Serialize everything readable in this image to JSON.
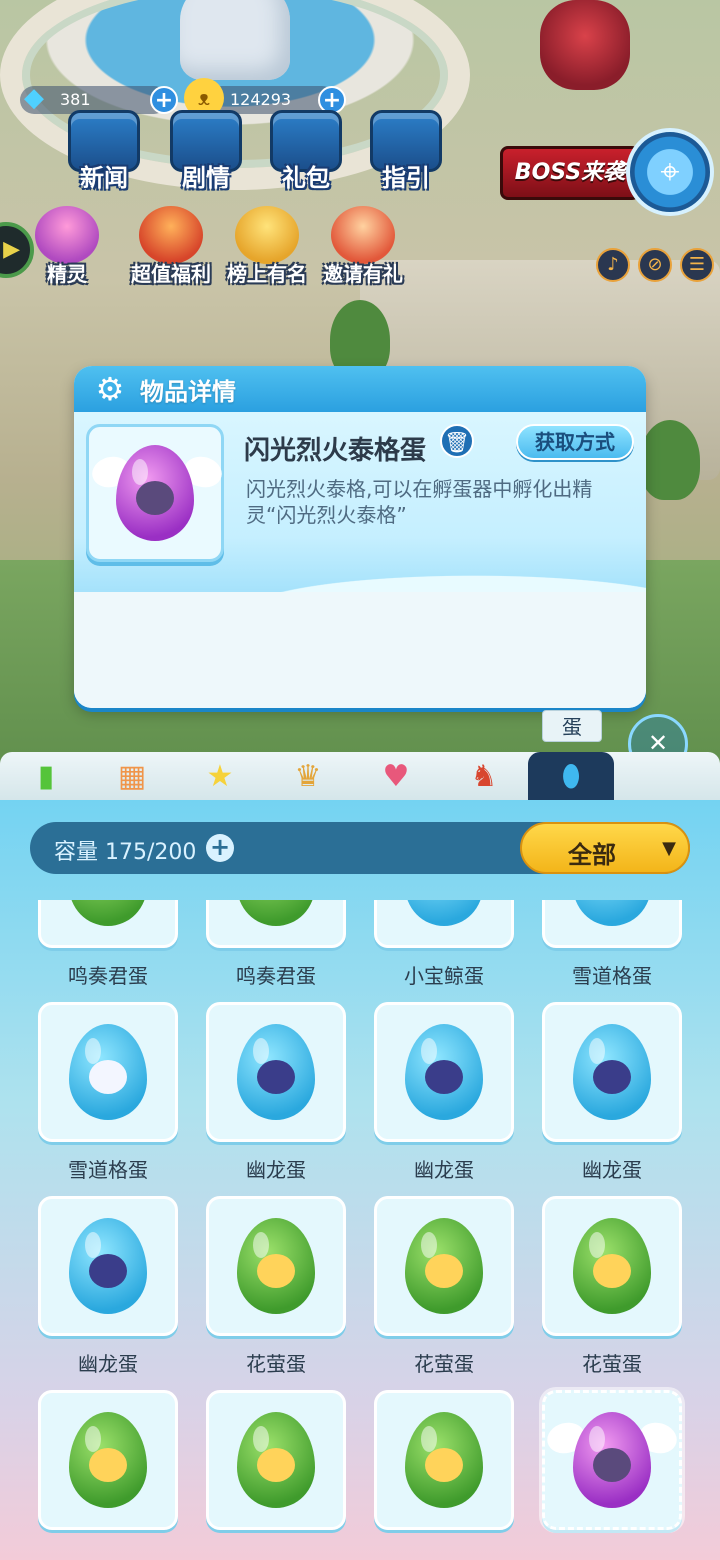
{
  "hud": {
    "diamonds": "381",
    "coins": "124293",
    "diamond_icon": "diamond-icon",
    "coin_icon": "cat-coin-icon"
  },
  "top_menu": [
    {
      "label": "新闻",
      "icon": "news-terminal-icon"
    },
    {
      "label": "剧情",
      "icon": "story-machine-icon"
    },
    {
      "label": "礼包",
      "icon": "gift-pack-icon"
    },
    {
      "label": "指引",
      "icon": "guide-machine-icon"
    }
  ],
  "boss_banner": "BOSS来袭",
  "second_menu": [
    {
      "label": "精灵",
      "icon": "spirit-trophy-icon"
    },
    {
      "label": "超值福利",
      "icon": "welfare-gift-icon"
    },
    {
      "label": "榜上有名",
      "icon": "leaderboard-cup-icon"
    },
    {
      "label": "邀请有礼",
      "icon": "invite-letter-icon"
    }
  ],
  "popup": {
    "title": "物品详情",
    "item_name": "闪光烈火泰格蛋",
    "acquire_label": "获取方式",
    "description": "闪光烈火泰格,可以在孵蛋器中孵化出精灵“闪光烈火泰格”"
  },
  "tabs": {
    "active_label": "蛋",
    "icons": [
      "battery-icon",
      "blocks-icon",
      "star-wand-icon",
      "crown-box-icon",
      "dress-icon",
      "rocking-horse-icon",
      "egg-icon"
    ]
  },
  "bag": {
    "capacity_label": "容量",
    "capacity_value": "175/200",
    "filter_label": "全部"
  },
  "items": [
    {
      "name": "鸣奏君蛋",
      "egg": "green",
      "face": "mix"
    },
    {
      "name": "鸣奏君蛋",
      "egg": "green",
      "face": "mix"
    },
    {
      "name": "小宝鲸蛋",
      "egg": "blue",
      "face": "dark"
    },
    {
      "name": "雪道格蛋",
      "egg": "blue",
      "face": "white"
    },
    {
      "name": "雪道格蛋",
      "egg": "blue",
      "face": "white"
    },
    {
      "name": "幽龙蛋",
      "egg": "blue",
      "face": "dark"
    },
    {
      "name": "幽龙蛋",
      "egg": "blue",
      "face": "dark"
    },
    {
      "name": "幽龙蛋",
      "egg": "blue",
      "face": "dark"
    },
    {
      "name": "幽龙蛋",
      "egg": "blue",
      "face": "dark"
    },
    {
      "name": "花萤蛋",
      "egg": "green",
      "face": "yellow"
    },
    {
      "name": "花萤蛋",
      "egg": "green",
      "face": "yellow"
    },
    {
      "name": "花萤蛋",
      "egg": "green",
      "face": "yellow"
    },
    {
      "name": "",
      "egg": "green",
      "face": "yellow"
    },
    {
      "name": "",
      "egg": "green",
      "face": "yellow"
    },
    {
      "name": "",
      "egg": "green",
      "face": "yellow"
    },
    {
      "name": "",
      "egg": "purple",
      "face": "mix",
      "selected": true
    }
  ]
}
